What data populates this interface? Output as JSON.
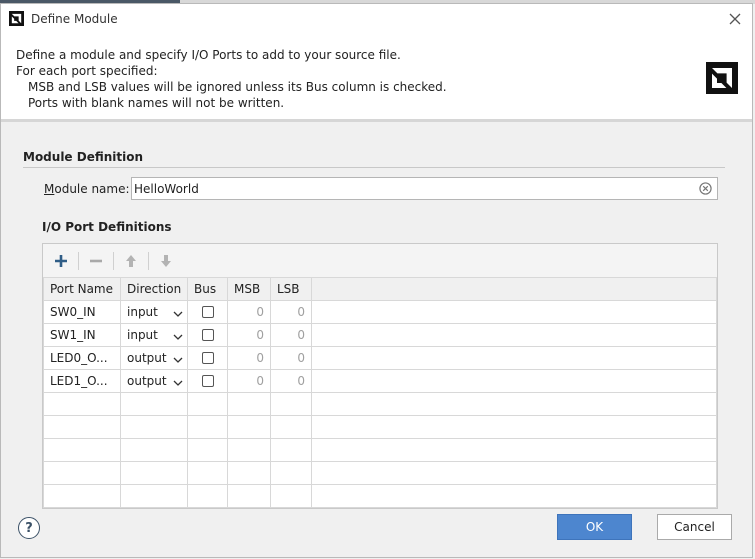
{
  "dialog": {
    "title": "Define Module",
    "close_icon": "close-icon",
    "logo_icon": "amd-logo-icon"
  },
  "header": {
    "line1": "Define a module and specify I/O Ports to add to your source file.",
    "line2": "For each port specified:",
    "line3": "MSB and LSB values will be ignored unless its Bus column is checked.",
    "line4": "Ports with blank names will not be written."
  },
  "module_definition": {
    "section_title": "Module Definition",
    "name_label_accel": "M",
    "name_label_rest": "odule name:",
    "name_value": "HelloWorld"
  },
  "io_ports": {
    "section_title": "I/O Port Definitions",
    "toolbar": [
      "add-icon",
      "remove-icon",
      "move-up-icon",
      "move-down-icon"
    ],
    "columns": [
      "Port Name",
      "Direction",
      "Bus",
      "MSB",
      "LSB"
    ],
    "rows": [
      {
        "name": "SW0_IN",
        "direction": "input",
        "bus": false,
        "msb": "0",
        "lsb": "0"
      },
      {
        "name": "SW1_IN",
        "direction": "input",
        "bus": false,
        "msb": "0",
        "lsb": "0"
      },
      {
        "name": "LED0_O...",
        "direction": "output",
        "bus": false,
        "msb": "0",
        "lsb": "0"
      },
      {
        "name": "LED1_O...",
        "direction": "output",
        "bus": false,
        "msb": "0",
        "lsb": "0"
      }
    ]
  },
  "footer": {
    "help_label": "?",
    "ok_label": "OK",
    "cancel_label": "Cancel"
  },
  "colors": {
    "accent": "#4d86cf",
    "panel_bg": "#f0f0f0"
  }
}
